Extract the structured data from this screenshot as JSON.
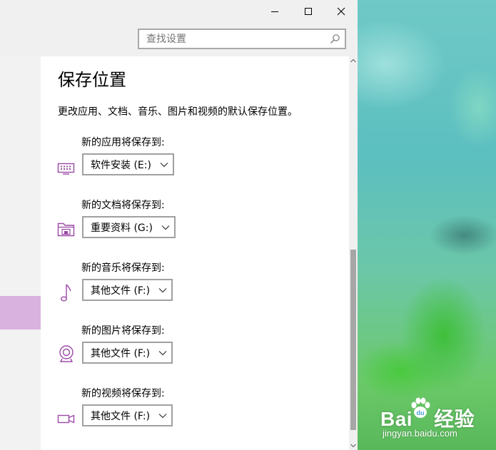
{
  "window": {
    "controls": {
      "minimize_icon": "minimize-icon",
      "maximize_icon": "maximize-icon",
      "close_icon": "close-icon"
    },
    "search": {
      "placeholder": "查找设置",
      "icon": "search-icon"
    }
  },
  "page": {
    "title": "保存位置",
    "description": "更改应用、文档、音乐、图片和视频的默认保存位置。"
  },
  "settings": [
    {
      "label": "新的应用将保存到:",
      "icon": "keyboard-icon",
      "value": "软件安装 (E:)"
    },
    {
      "label": "新的文档将保存到:",
      "icon": "folder-drive-icon",
      "value": "重要资料 (G:)"
    },
    {
      "label": "新的音乐将保存到:",
      "icon": "music-note-icon",
      "value": "其他文件 (F:)"
    },
    {
      "label": "新的图片将保存到:",
      "icon": "camera-icon",
      "value": "其他文件 (F:)"
    },
    {
      "label": "新的视频将保存到:",
      "icon": "video-camera-icon",
      "value": "其他文件 (F:)"
    }
  ],
  "colors": {
    "accent_icon": "#9b4aa6",
    "sidebar_selected": "#d9b2e0",
    "titlebar": "#f0f0f0"
  },
  "watermark": {
    "brand": "Bai",
    "brand_suffix": "经验",
    "brand_paw": "du",
    "url": "jingyan.baidu.com"
  }
}
